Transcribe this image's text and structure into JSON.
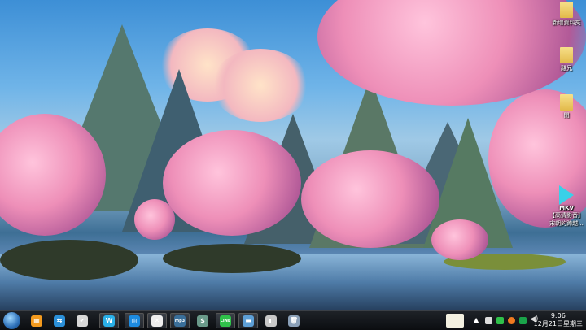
{
  "desktop_icons": [
    {
      "label": "新增資料夾",
      "type": "folder"
    },
    {
      "label": "離兄",
      "type": "folder"
    },
    {
      "label": "閒",
      "type": "folder"
    },
    {
      "label": "【高清影音】宋朝的跨越...",
      "type": "mkv-video",
      "badge": "MKV"
    }
  ],
  "taskbar": {
    "pinned": [
      {
        "name": "calculator",
        "glyph": "▦",
        "color": "#f39a1e"
      },
      {
        "name": "file-transfer",
        "glyph": "⇆",
        "color": "#2b8fd8"
      },
      {
        "name": "checklist",
        "glyph": "✔",
        "color": "#d8d8d8"
      },
      {
        "name": "w-app",
        "glyph": "W",
        "color": "#2ab0e8"
      },
      {
        "name": "teamviewer-like",
        "glyph": "◎",
        "color": "#1d8be0"
      },
      {
        "name": "fox-app",
        "glyph": "✕",
        "color": "#eeeeee"
      },
      {
        "name": "mp3-tool",
        "glyph": "mp3",
        "color": "#3a6f9a"
      },
      {
        "name": "money-app",
        "glyph": "$",
        "color": "#6a9a8a"
      },
      {
        "name": "line",
        "glyph": "LINE",
        "color": "#2fc14a"
      },
      {
        "name": "file-explorer",
        "glyph": "▬",
        "color": "#5d9fd6"
      },
      {
        "name": "speaker-app",
        "glyph": "◐",
        "color": "#c8c8c8"
      },
      {
        "name": "recycle-bin",
        "glyph": "🗑",
        "color": "#8aa0b8"
      }
    ],
    "clock": {
      "time": "9:06",
      "date": "12月21日星期三"
    }
  }
}
